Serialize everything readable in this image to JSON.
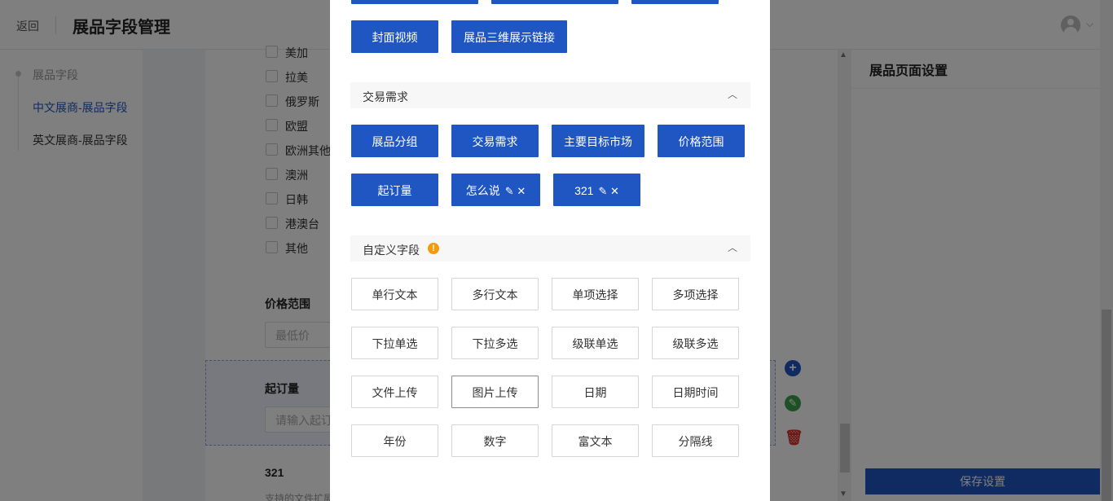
{
  "header": {
    "back_label": "返回",
    "page_title": "展品字段管理"
  },
  "left_nav": {
    "group_label": "展品字段",
    "items": [
      {
        "label": "中文展商-展品字段",
        "active": true
      },
      {
        "label": "英文展商-展品字段",
        "active": false
      }
    ]
  },
  "form": {
    "regions": [
      "美加",
      "拉美",
      "俄罗斯",
      "欧盟",
      "欧洲其他",
      "澳洲",
      "日韩",
      "港澳台",
      "其他"
    ],
    "price_range": {
      "title": "价格范围",
      "min_placeholder": "最低价"
    },
    "moq": {
      "title": "起订量",
      "placeholder": "请输入起订量"
    },
    "custom_field": {
      "title": "321",
      "hint": "支持的文件扩展名"
    }
  },
  "tools": {
    "add": "+",
    "edit": "✎",
    "delete": "🗑"
  },
  "right_panel": {
    "title": "展品页面设置",
    "save_label": "保存设置"
  },
  "modal": {
    "top_buttons": [
      "封面视频",
      "展品三维展示链接"
    ],
    "trade_section": {
      "title": "交易需求",
      "buttons": [
        "展品分组",
        "交易需求",
        "主要目标市场",
        "价格范围",
        "起订量"
      ],
      "custom_buttons": [
        "怎么说",
        "321"
      ]
    },
    "custom_section": {
      "title": "自定义字段",
      "buttons": [
        "单行文本",
        "多行文本",
        "单项选择",
        "多项选择",
        "下拉单选",
        "下拉多选",
        "级联单选",
        "级联多选",
        "文件上传",
        "图片上传",
        "日期",
        "日期时间",
        "年份",
        "数字",
        "富文本",
        "分隔线"
      ]
    }
  },
  "colors": {
    "primary": "#1f56c2",
    "warning": "#f59a0a",
    "edit_green": "#3aa14a",
    "delete_red": "#d9332b",
    "add_blue": "#1f56c2"
  }
}
